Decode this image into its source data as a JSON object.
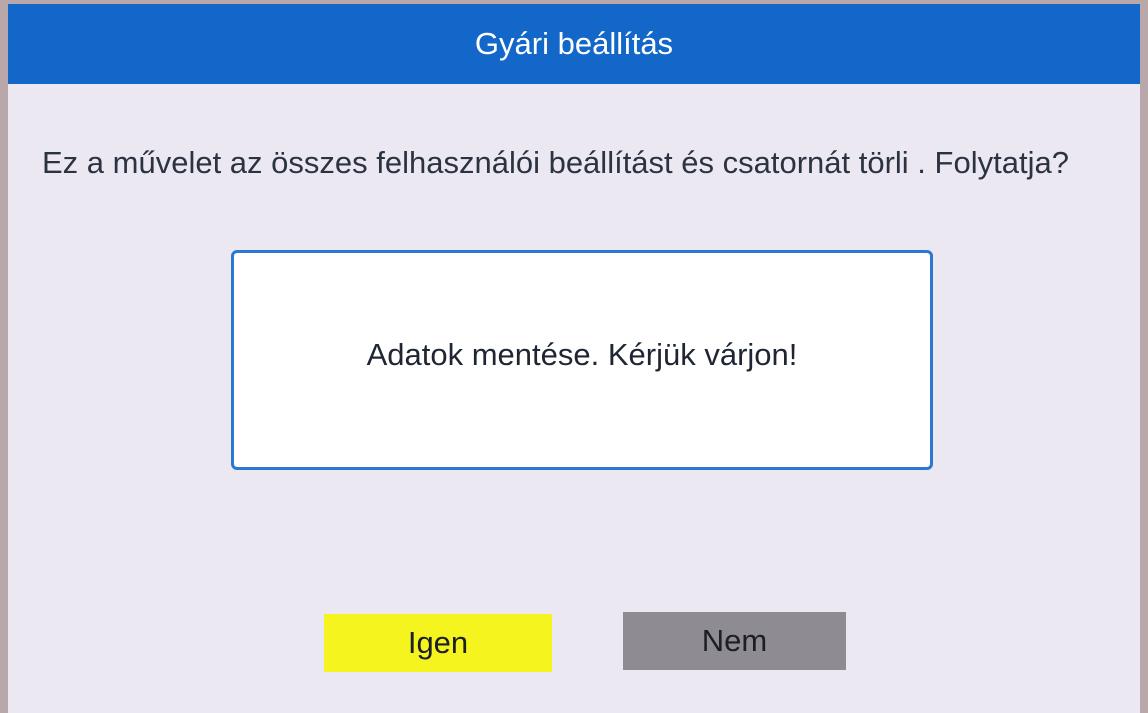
{
  "dialog": {
    "title": "Gyári beállítás",
    "message": "Ez a művelet az összes felhasználói beállítást és csatornát törli . Folytatja?",
    "status": "Adatok mentése. Kérjük várjon!",
    "buttons": {
      "yes_label": "Igen",
      "no_label": "Nem"
    }
  },
  "colors": {
    "titlebar": "#1367c8",
    "background": "#ece8f2",
    "selected_button": "#f5f41e",
    "unselected_button": "#8f8b92",
    "status_border": "#2a78cf"
  }
}
